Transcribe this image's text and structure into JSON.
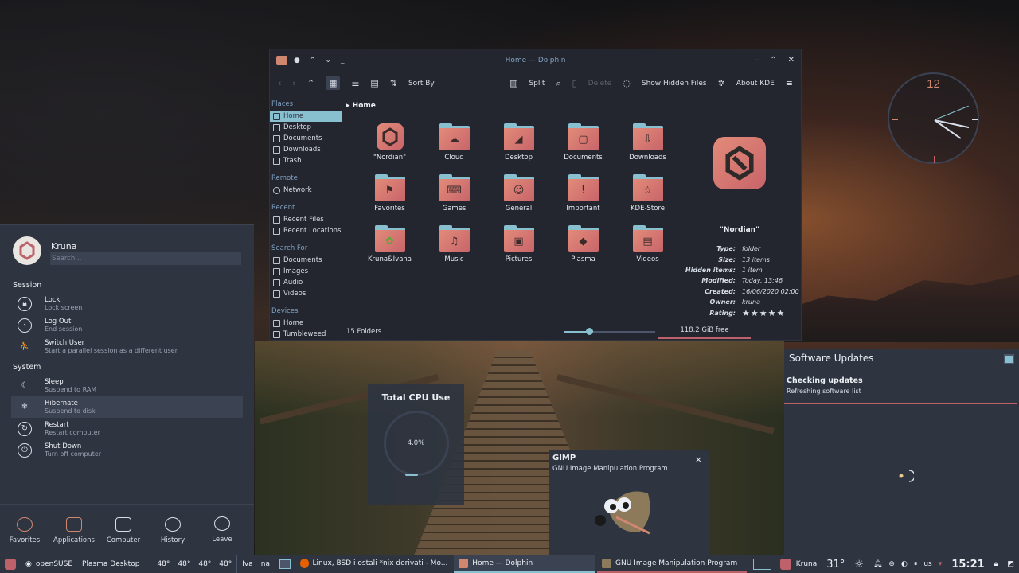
{
  "dolphin": {
    "title": "Home — Dolphin",
    "toolbar": {
      "sort_label": "Sort By",
      "split_label": "Split",
      "delete_label": "Delete",
      "hidden_label": "Show Hidden Files",
      "about_label": "About KDE"
    },
    "places": {
      "places_header": "Places",
      "remote_header": "Remote",
      "recent_header": "Recent",
      "search_header": "Search For",
      "devices_header": "Devices",
      "places_items": [
        "Home",
        "Desktop",
        "Documents",
        "Downloads",
        "Trash"
      ],
      "remote_items": [
        "Network"
      ],
      "recent_items": [
        "Recent Files",
        "Recent Locations"
      ],
      "search_items": [
        "Documents",
        "Images",
        "Audio",
        "Videos"
      ],
      "device_items": [
        "Home",
        "Tumbleweed"
      ]
    },
    "breadcrumb": "Home",
    "files": [
      {
        "name": "\"Nordian\"",
        "glyph": "N"
      },
      {
        "name": "Cloud",
        "glyph": "☁"
      },
      {
        "name": "Desktop",
        "glyph": "◢"
      },
      {
        "name": "Documents",
        "glyph": "▢"
      },
      {
        "name": "Downloads",
        "glyph": "⇩"
      },
      {
        "name": "Favorites",
        "glyph": "⚑"
      },
      {
        "name": "Games",
        "glyph": "⌨"
      },
      {
        "name": "General",
        "glyph": "☺"
      },
      {
        "name": "Important",
        "glyph": "!"
      },
      {
        "name": "KDE-Store",
        "glyph": "☆"
      },
      {
        "name": "Kruna&Ivana",
        "glyph": "✿"
      },
      {
        "name": "Music",
        "glyph": "♫"
      },
      {
        "name": "Pictures",
        "glyph": "▣"
      },
      {
        "name": "Plasma",
        "glyph": "◆"
      },
      {
        "name": "Videos",
        "glyph": "▤"
      }
    ],
    "info": {
      "name": "\"Nordian\"",
      "rows": [
        {
          "k": "Type:",
          "v": "folder"
        },
        {
          "k": "Size:",
          "v": "13 items"
        },
        {
          "k": "Hidden items:",
          "v": "1 item"
        },
        {
          "k": "Modified:",
          "v": "Today, 13:46"
        },
        {
          "k": "Created:",
          "v": "16/06/2020 02:00"
        },
        {
          "k": "Owner:",
          "v": "kruna"
        }
      ],
      "rating_label": "Rating:",
      "rating": 5
    },
    "status": {
      "folders": "15 Folders",
      "zoom_fraction": 0.28,
      "free": "118.2 GiB free"
    }
  },
  "clock": {
    "twelve": "12"
  },
  "kickoff": {
    "user": "Kruna",
    "search_placeholder": "Search...",
    "session_header": "Session",
    "system_header": "System",
    "session_items": [
      {
        "title": "Lock",
        "sub": "Lock screen",
        "icon": "lock-icon"
      },
      {
        "title": "Log Out",
        "sub": "End session",
        "icon": "logout-icon"
      },
      {
        "title": "Switch User",
        "sub": "Start a parallel session as a different user",
        "icon": "switch-user-icon"
      }
    ],
    "system_items": [
      {
        "title": "Sleep",
        "sub": "Suspend to RAM",
        "icon": "sleep-icon"
      },
      {
        "title": "Hibernate",
        "sub": "Suspend to disk",
        "icon": "hibernate-icon"
      },
      {
        "title": "Restart",
        "sub": "Restart computer",
        "icon": "restart-icon"
      },
      {
        "title": "Shut Down",
        "sub": "Turn off computer",
        "icon": "power-icon"
      }
    ],
    "tabs": [
      "Favorites",
      "Applications",
      "Computer",
      "History",
      "Leave"
    ]
  },
  "cpu": {
    "title": "Total CPU Use",
    "value": "4.0%"
  },
  "gimp_notification": {
    "title": "GIMP",
    "subtitle": "GNU Image Manipulation Program",
    "close": "×"
  },
  "updates": {
    "title": "Software Updates",
    "checking": "Checking updates",
    "refreshing": "Refreshing software list"
  },
  "taskbar": {
    "distro": "openSUSE",
    "desktop": "Plasma Desktop",
    "temps": [
      "48°",
      "48°",
      "48°",
      "48°"
    ],
    "users": [
      "Iva",
      "na"
    ],
    "tasks": [
      {
        "label": "Linux, BSD i ostali *nix derivati - Mo...",
        "color": "#e66000"
      },
      {
        "label": "Home — Dolphin",
        "color": "#d08770"
      },
      {
        "label": "GNU Image Manipulation Program",
        "color": "#8c7a5a"
      }
    ],
    "user": "Kruna",
    "weather_temp": "31°",
    "keyboard": "us",
    "time": "15:21"
  }
}
